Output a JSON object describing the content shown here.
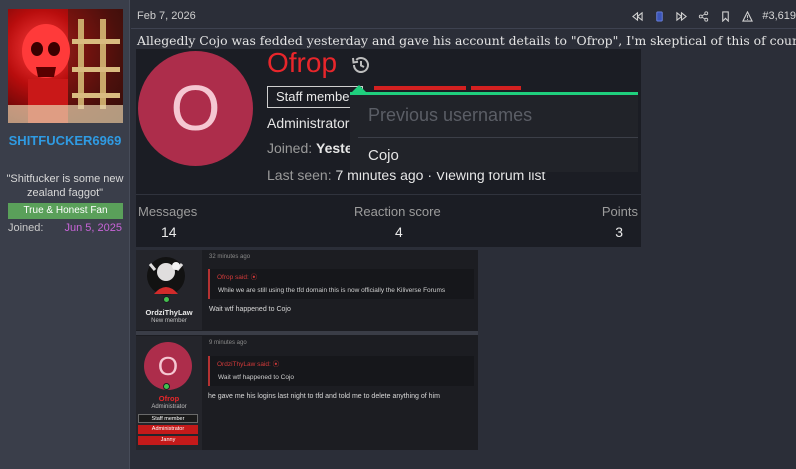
{
  "author": {
    "username": "SHITFUCKER6969",
    "user_title": "\"Shitfucker is some new zealand faggot\"",
    "banner": "True & Honest Fan",
    "joined_label": "Joined:",
    "joined_value": "Jun 5, 2025"
  },
  "post": {
    "date": "Feb 7, 2026",
    "number": "#3,619",
    "text": "Allegedly Cojo was fedded yesterday and gave his account details to \"Ofrop\", I'm skeptical of this of course."
  },
  "profile_card": {
    "avatar_letter": "O",
    "name": "Ofrop",
    "staff_badge": "Staff member",
    "role": "Administrator",
    "joined_label": "Joined:",
    "joined_value": "Yesterday",
    "last_seen_label": "Last seen:",
    "last_seen_value": "7 minutes ago · Viewing forum list",
    "stats": [
      {
        "label": "Messages",
        "value": "14"
      },
      {
        "label": "Reaction score",
        "value": "4"
      },
      {
        "label": "Points",
        "value": "3"
      }
    ],
    "tooltip": {
      "heading": "Previous usernames",
      "items": [
        "Cojo"
      ]
    }
  },
  "thread": {
    "posts": [
      {
        "username": "OrdziThyLaw",
        "user_title": "New member",
        "time": "32 minutes ago",
        "quote_author": "Ofrop said: ⦿",
        "quote_text": "While we are still using the tfd domain this is now officially the Kiliverse Forums",
        "message": "Wait wtf happened to Cojo"
      },
      {
        "avatar_letter": "O",
        "username": "Ofrop",
        "user_title": "Administrator",
        "badges": [
          "Staff member",
          "Administrator",
          "Janny"
        ],
        "time": "9 minutes ago",
        "quote_author": "OrdziThyLaw said: ⦿",
        "quote_text": "Wait wtf happened to Cojo",
        "message": "he gave me his logins last night to tfd and told me to delete anything of him"
      }
    ]
  },
  "colors": {
    "username_blue": "#2f9be3",
    "banner_green": "#5aa05a",
    "joined_purple": "#c864d8",
    "profile_red": "#e8262b",
    "tooltip_accent": "#1fcf7d",
    "avatar_pink": "#ad2d4b"
  }
}
